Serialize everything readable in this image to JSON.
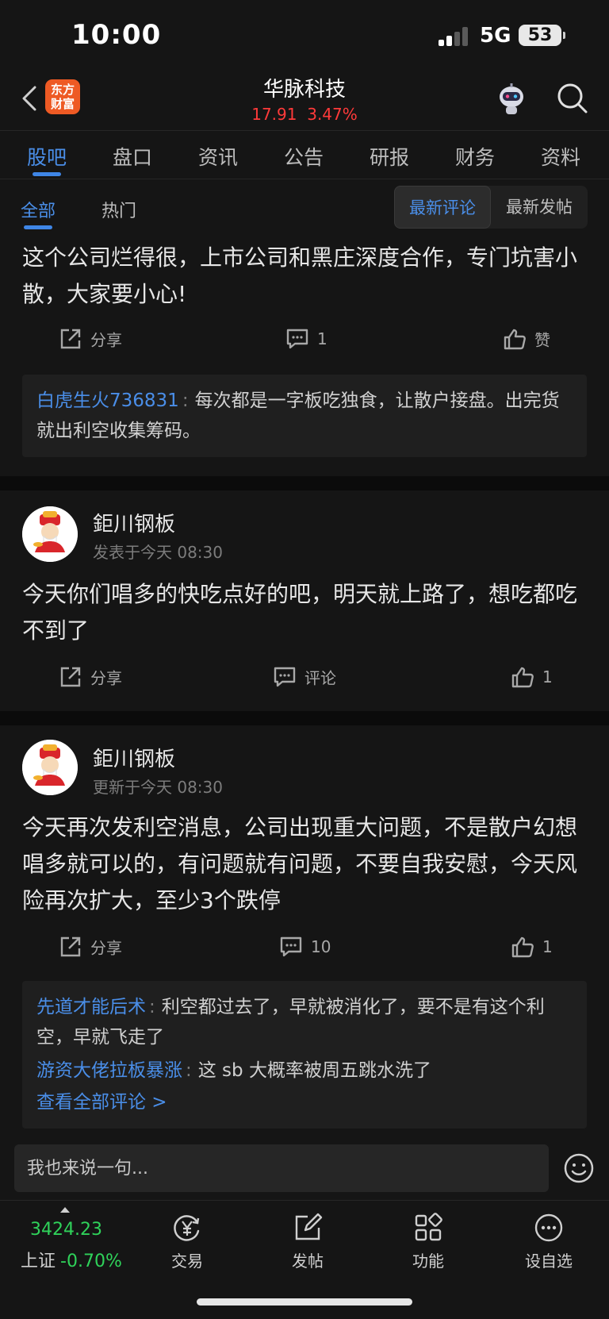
{
  "status_bar": {
    "time": "10:00",
    "network": "5G",
    "battery": "53"
  },
  "header": {
    "logo_text": "东方财富",
    "stock_name": "华脉科技",
    "price": "17.91",
    "change": "3.47%"
  },
  "tabs": [
    "股吧",
    "盘口",
    "资讯",
    "公告",
    "研报",
    "财务",
    "资料"
  ],
  "filter": {
    "tabs": [
      "全部",
      "热门"
    ],
    "sort_options": [
      "最新评论",
      "最新发帖"
    ]
  },
  "post1": {
    "text": "这个公司烂得很，上市公司和黑庄深度合作，专门坑害小散，大家要小心!",
    "share": "分享",
    "comments": "1",
    "like": "赞",
    "replies": [
      {
        "user": "白虎生火736831",
        "colon": ":",
        "text": "每次都是一字板吃独食，让散户接盘。出完货就出利空收集筹码。"
      }
    ]
  },
  "post2": {
    "author": "鉅川钢板",
    "time": "发表于今天 08:30",
    "text": "今天你们唱多的快吃点好的吧，明天就上路了，想吃都吃不到了",
    "share": "分享",
    "comment": "评论",
    "likes": "1"
  },
  "post3": {
    "author": "鉅川钢板",
    "time": "更新于今天 08:30",
    "text": "今天再次发利空消息，公司出现重大问题，不是散户幻想唱多就可以的，有问题就有问题，不要自我安慰，今天风险再次扩大，至少3个跌停",
    "share": "分享",
    "comments": "10",
    "likes": "1",
    "replies": [
      {
        "user": "先道才能后术",
        "colon": ":",
        "text": "利空都过去了，早就被消化了，要不是有这个利空，早就飞走了"
      },
      {
        "user": "游资大佬拉板暴涨",
        "colon": ":",
        "text": "这 sb 大概率被周五跳水洗了"
      }
    ],
    "view_all": "查看全部评论 >"
  },
  "comment_input": {
    "placeholder": "我也来说一句..."
  },
  "bottom_nav": {
    "index_value": "3424.23",
    "index_name": "上证",
    "index_change": "-0.70%",
    "items": [
      "交易",
      "发帖",
      "功能",
      "设自选"
    ]
  },
  "colors": {
    "accent": "#4a8ee8",
    "up": "#ff3a3a",
    "down": "#2fd25a",
    "background": "#151515"
  }
}
